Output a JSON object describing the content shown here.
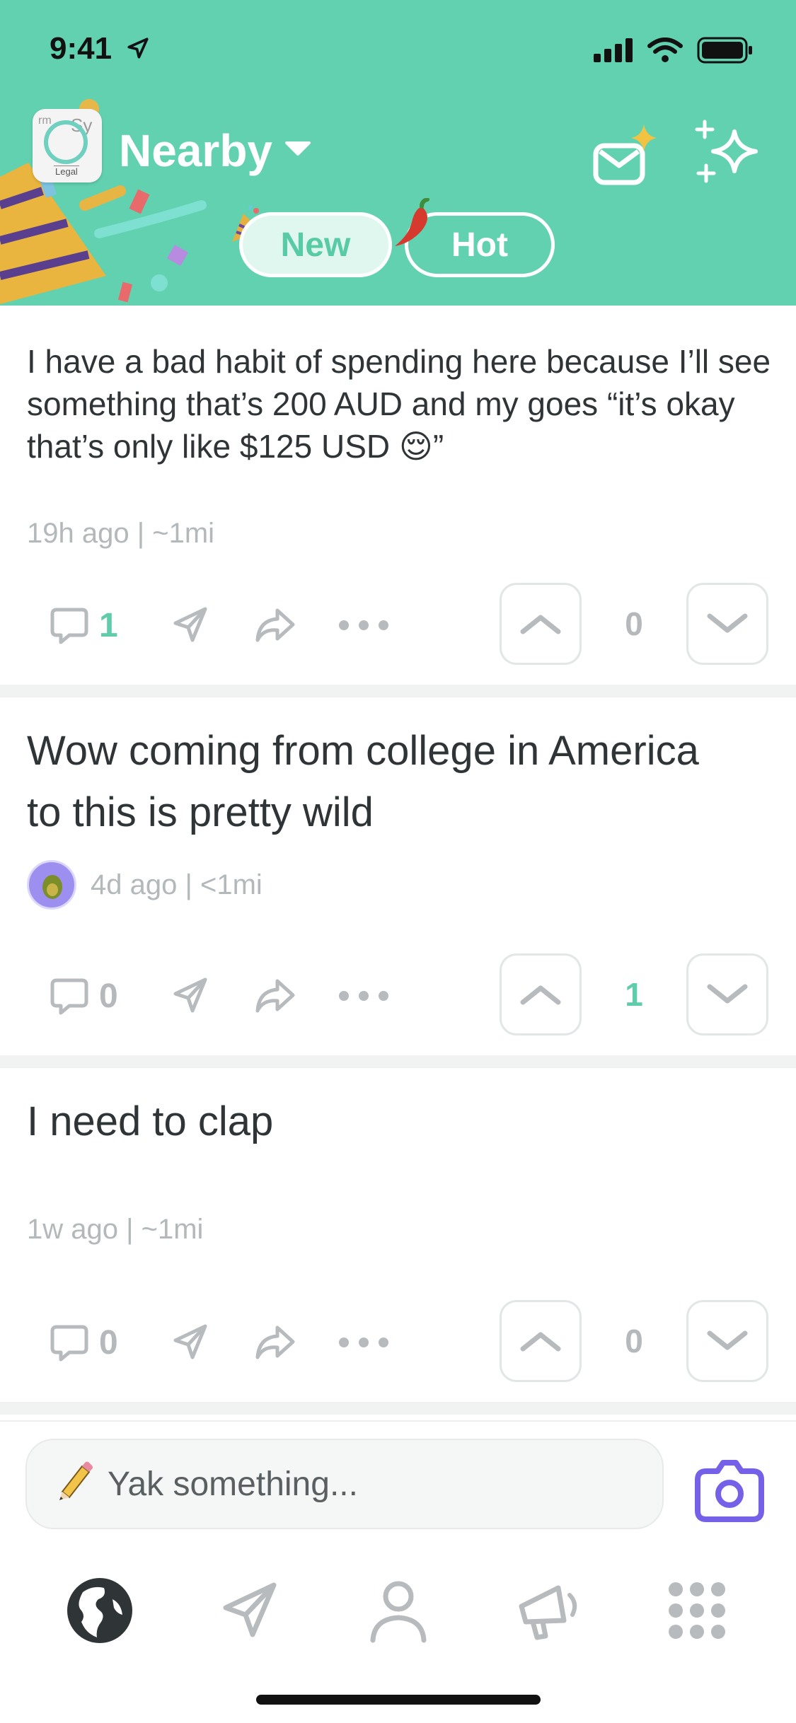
{
  "status_bar": {
    "time": "9:41"
  },
  "header": {
    "logo": {
      "text_top": "Sy",
      "text_tm": "rm",
      "text_bottom": "Legal"
    },
    "title": "Nearby",
    "tabs": [
      {
        "label": "New",
        "active": true
      },
      {
        "label": "Hot",
        "active": false
      }
    ]
  },
  "posts": [
    {
      "text": "I have a bad habit of spending here because I’ll see something that’s 200 AUD and my goes “it’s okay that’s only like $125 USD 😌”",
      "meta": "19h ago | ~1mi",
      "comments": "1",
      "score": "0"
    },
    {
      "text": "Wow coming from college in America to this is pretty wild",
      "meta": "4d ago | <1mi",
      "comments": "0",
      "score": "1"
    },
    {
      "text": "I need to clap",
      "meta": "1w ago | ~1mi",
      "comments": "0",
      "score": "0"
    }
  ],
  "compose": {
    "placeholder": "Yak something..."
  },
  "colors": {
    "brand": "#62d1b0",
    "accent_green": "#5fcda9",
    "camera": "#7561e8"
  }
}
